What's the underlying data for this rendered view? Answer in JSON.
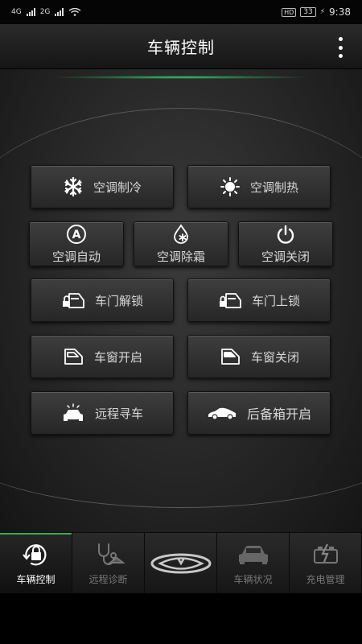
{
  "status_bar": {
    "network_1": "4G",
    "network_2": "2G",
    "hd": "HD",
    "battery": "33",
    "time": "9:38"
  },
  "header": {
    "title": "车辆控制",
    "menu_icon": "more-vertical-icon"
  },
  "controls": {
    "ac_cool": {
      "label": "空调制冷",
      "icon": "snowflake-icon"
    },
    "ac_heat": {
      "label": "空调制热",
      "icon": "sun-icon"
    },
    "ac_auto": {
      "label": "空调自动",
      "icon": "auto-a-icon"
    },
    "ac_defrost": {
      "label": "空调除霜",
      "icon": "defrost-drop-icon"
    },
    "ac_off": {
      "label": "空调关闭",
      "icon": "power-icon"
    },
    "door_unlock": {
      "label": "车门解锁",
      "icon": "door-unlock-icon"
    },
    "door_lock": {
      "label": "车门上锁",
      "icon": "door-lock-icon"
    },
    "window_open": {
      "label": "车窗开启",
      "icon": "window-open-icon"
    },
    "window_close": {
      "label": "车窗关闭",
      "icon": "window-close-icon"
    },
    "find_car": {
      "label": "远程寻车",
      "icon": "car-flash-icon"
    },
    "trunk_open": {
      "label": "后备箱开启",
      "icon": "car-side-icon"
    }
  },
  "tabbar": {
    "tabs": [
      {
        "label": "车辆控制",
        "icon": "car-lock-icon",
        "active": true
      },
      {
        "label": "远程诊断",
        "icon": "stethoscope-icon",
        "active": false
      },
      {
        "label": "",
        "icon": "brand-logo-icon",
        "active": false
      },
      {
        "label": "车辆状况",
        "icon": "car-front-icon",
        "active": false
      },
      {
        "label": "充电管理",
        "icon": "battery-charge-icon",
        "active": false
      }
    ]
  },
  "colors": {
    "accent_green": "#2fae5c",
    "button_bg": "#333333",
    "text": "#d8d8d8"
  }
}
